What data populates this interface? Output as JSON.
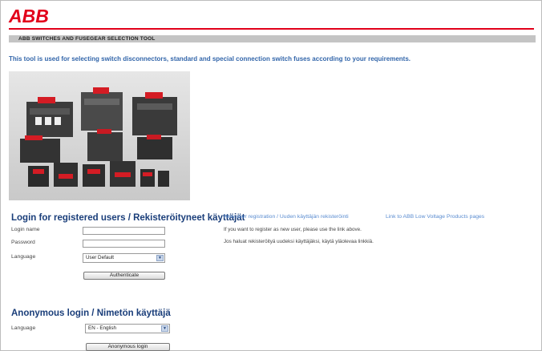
{
  "brand": {
    "logo_text": "ABB",
    "brand_color": "#e2001a"
  },
  "header": {
    "tool_title": "ABB SWITCHES AND FUSEGEAR SELECTION TOOL"
  },
  "intro": "This tool is used for selecting switch disconnectors, standard and special connection switch fuses according to your requirements.",
  "login": {
    "title": "Login for registered users / Rekisteröityneet käyttäjät",
    "login_name_label": "Login name",
    "login_name_value": "",
    "password_label": "Password",
    "password_value": "",
    "language_label": "Language",
    "language_selected": "User Default",
    "authenticate_label": "Authenticate"
  },
  "links": {
    "registration": "New user registration / Uuden käyttäjän rekisteröinti",
    "abb_products": "Link to ABB Low Voltage Products pages"
  },
  "info": {
    "english": "If you want to register as new user, please use the link above.",
    "finnish": "Jos haluat rekisteröityä uudeksi käyttäjäksi, käytä yläolevaa linkkiä."
  },
  "anonymous": {
    "title": "Anonymous login / Nimetön käyttäjä",
    "language_label": "Language",
    "language_selected": "EN - English",
    "login_label": "Anonymous login"
  },
  "colors": {
    "accent": "#1a3e7a",
    "link": "#5a8cd0",
    "intro_text": "#3366aa"
  }
}
